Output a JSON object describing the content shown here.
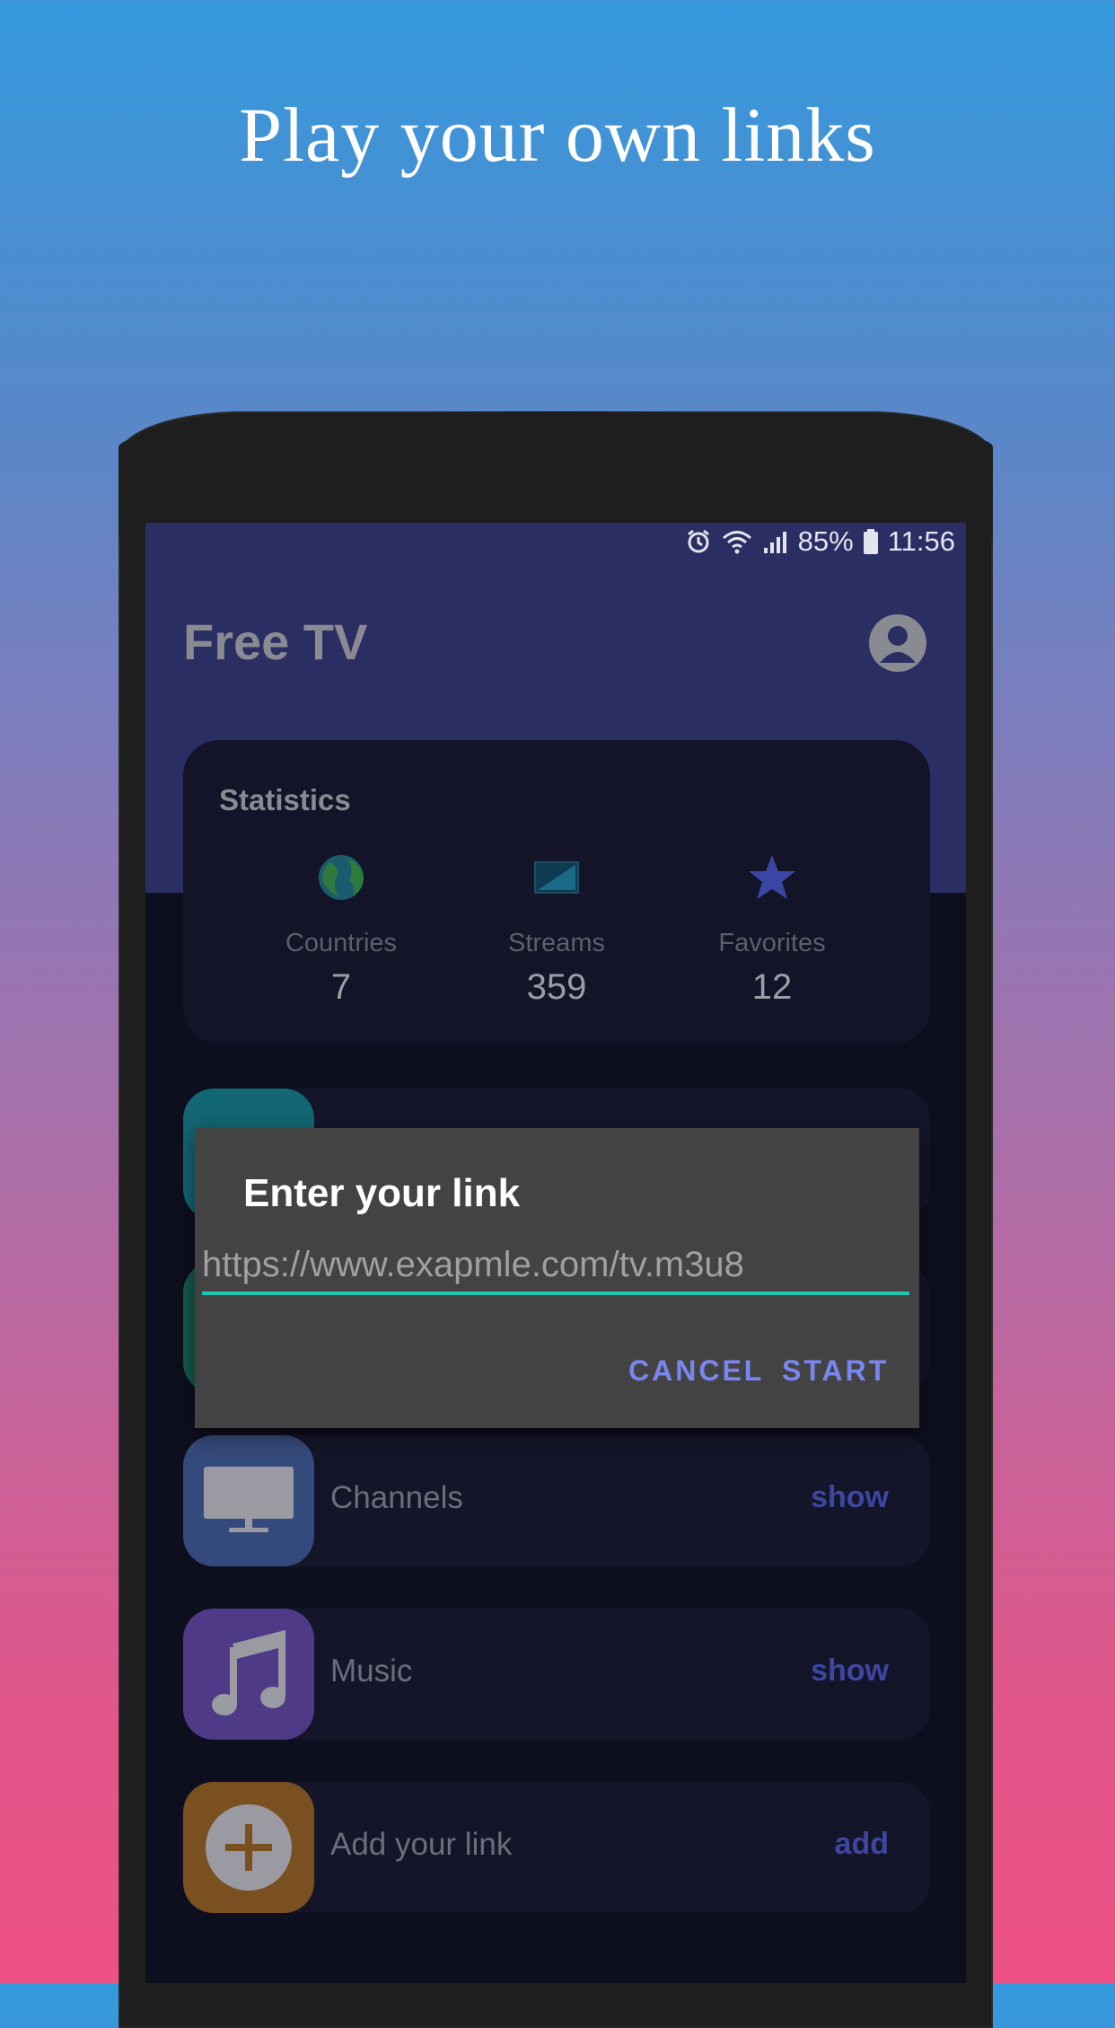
{
  "headline": "Play your own links",
  "status_bar": {
    "battery": "85%",
    "time": "11:56"
  },
  "app": {
    "title": "Free TV"
  },
  "statistics": {
    "title": "Statistics",
    "items": [
      {
        "label": "Countries",
        "value": "7"
      },
      {
        "label": "Streams",
        "value": "359"
      },
      {
        "label": "Favorites",
        "value": "12"
      }
    ]
  },
  "list": [
    {
      "label": "Channels",
      "action": "show",
      "icon": "monitor-icon",
      "color": "#354a7c"
    },
    {
      "label": "Music",
      "action": "show",
      "icon": "music-note-icon",
      "color": "#4e3a86"
    },
    {
      "label": "Add your link",
      "action": "add",
      "icon": "plus-circle-icon",
      "color": "#7a5021"
    }
  ],
  "dialog": {
    "title": "Enter your link",
    "input_value": "https://www.exapmle.com/tv.m3u8",
    "cancel_label": "CANCEL",
    "start_label": "START"
  },
  "colors": {
    "accent": "#1fc9b4",
    "button": "#7a86f0",
    "header": "#2b2e63"
  }
}
